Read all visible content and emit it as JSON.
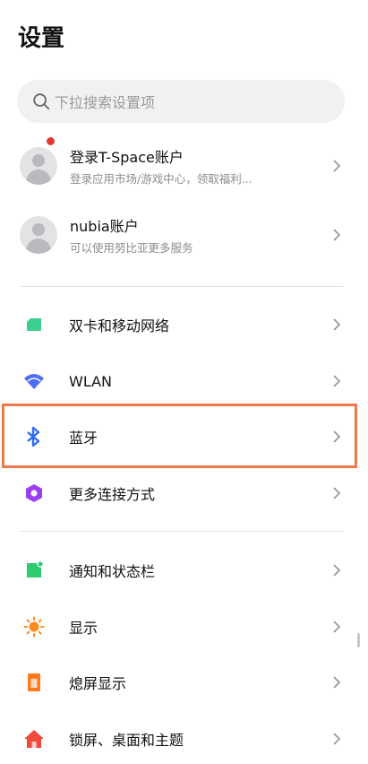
{
  "header": {
    "title": "设置"
  },
  "search": {
    "placeholder": "下拉搜索设置项"
  },
  "accounts": [
    {
      "title": "登录T-Space账户",
      "subtitle": "登录应用市场/游戏中心，领取福利...",
      "has_notification": true
    },
    {
      "title": "nubia账户",
      "subtitle": "可以使用努比亚更多服务",
      "has_notification": false
    }
  ],
  "settings": [
    {
      "label": "双卡和移动网络",
      "icon": "sim-card-icon",
      "color": "#3ccf8e"
    },
    {
      "label": "WLAN",
      "icon": "wifi-icon",
      "color": "#4f6ef7"
    },
    {
      "label": "蓝牙",
      "icon": "bluetooth-icon",
      "color": "#2f6df6",
      "highlighted": true
    },
    {
      "label": "更多连接方式",
      "icon": "connection-icon",
      "color": "#9b3ff0"
    },
    {
      "label": "通知和状态栏",
      "icon": "notification-icon",
      "color": "#2ecc71"
    },
    {
      "label": "显示",
      "icon": "brightness-icon",
      "color": "#ff8a1f"
    },
    {
      "label": "熄屏显示",
      "icon": "always-on-display-icon",
      "color": "#ff7a1a"
    },
    {
      "label": "锁屏、桌面和主题",
      "icon": "home-icon",
      "color": "#f04a3c"
    }
  ]
}
